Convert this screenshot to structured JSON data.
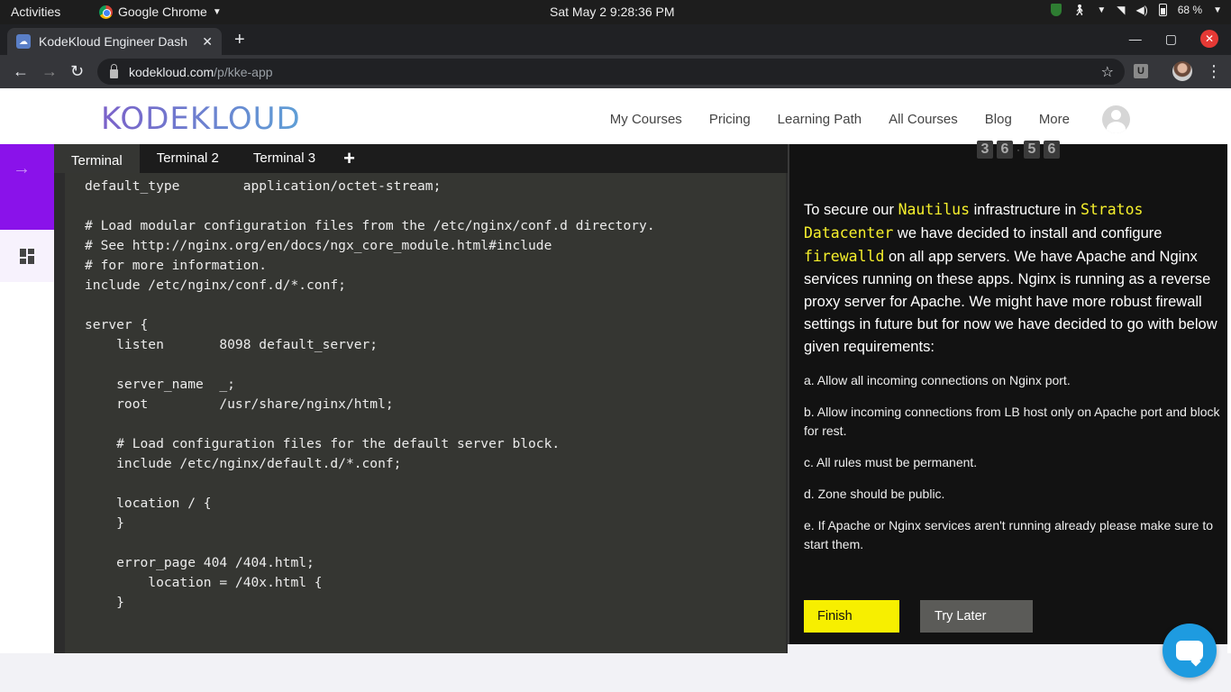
{
  "os_bar": {
    "activities": "Activities",
    "app_name": "Google Chrome",
    "clock": "Sat May 2   9:28:36 PM",
    "battery": "68 %"
  },
  "browser": {
    "tab_title": "KodeKloud Engineer Dash",
    "url_domain": "kodekloud.com",
    "url_path": "/p/kke-app",
    "ext_label": "U"
  },
  "site": {
    "logo": "KODEKLOUD",
    "nav": [
      "My Courses",
      "Pricing",
      "Learning Path",
      "All Courses",
      "Blog",
      "More"
    ]
  },
  "terminal": {
    "tabs": [
      "Terminal",
      "Terminal 2",
      "Terminal 3"
    ],
    "add_tab": "+",
    "content": "default_type        application/octet-stream;\n\n# Load modular configuration files from the /etc/nginx/conf.d directory.\n# See http://nginx.org/en/docs/ngx_core_module.html#include\n# for more information.\ninclude /etc/nginx/conf.d/*.conf;\n\nserver {\n    listen       8098 default_server;\n\n    server_name  _;\n    root         /usr/share/nginx/html;\n\n    # Load configuration files for the default server block.\n    include /etc/nginx/default.d/*.conf;\n\n    location / {\n    }\n\n    error_page 404 /404.html;\n        location = /40x.html {\n    }"
  },
  "task": {
    "timer_digits": [
      "3",
      "6",
      "5",
      "6"
    ],
    "intro_1": "To secure our ",
    "hl_1": "Nautilus",
    "intro_2": " infrastructure in ",
    "hl_2": "Stratos Datacenter",
    "intro_3": " we have decided to install and configure ",
    "hl_3": "firewalld",
    "intro_4": " on all app servers. We have Apache and Nginx services running on these apps. Nginx is running as a reverse proxy server for Apache. We might have more robust firewall settings in future but for now we have decided to go with below given requirements:",
    "requirements": [
      "a. Allow all incoming connections on Nginx port.",
      "b. Allow incoming connections from LB host only on Apache port and block for rest.",
      "c. All rules must be permanent.",
      "d. Zone should be public.",
      "e. If Apache or Nginx services aren't running already please make sure to start them."
    ],
    "finish_label": "Finish",
    "try_later_label": "Try Later"
  }
}
